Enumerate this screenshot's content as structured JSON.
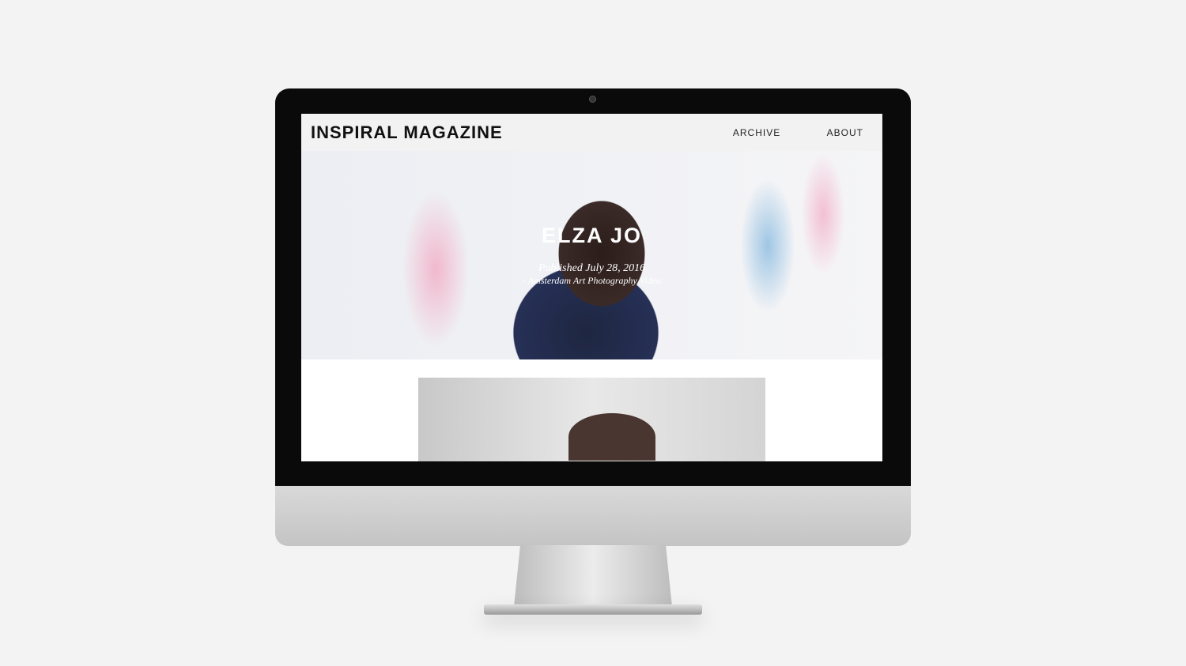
{
  "site": {
    "logo": "INSPIRAL MAGAZINE",
    "nav": [
      "ARCHIVE",
      "ABOUT"
    ]
  },
  "hero": {
    "title": "ELZA JO",
    "published": "Published July 28, 2016",
    "subtitle": "- Amsterdam Art Photography Video"
  }
}
